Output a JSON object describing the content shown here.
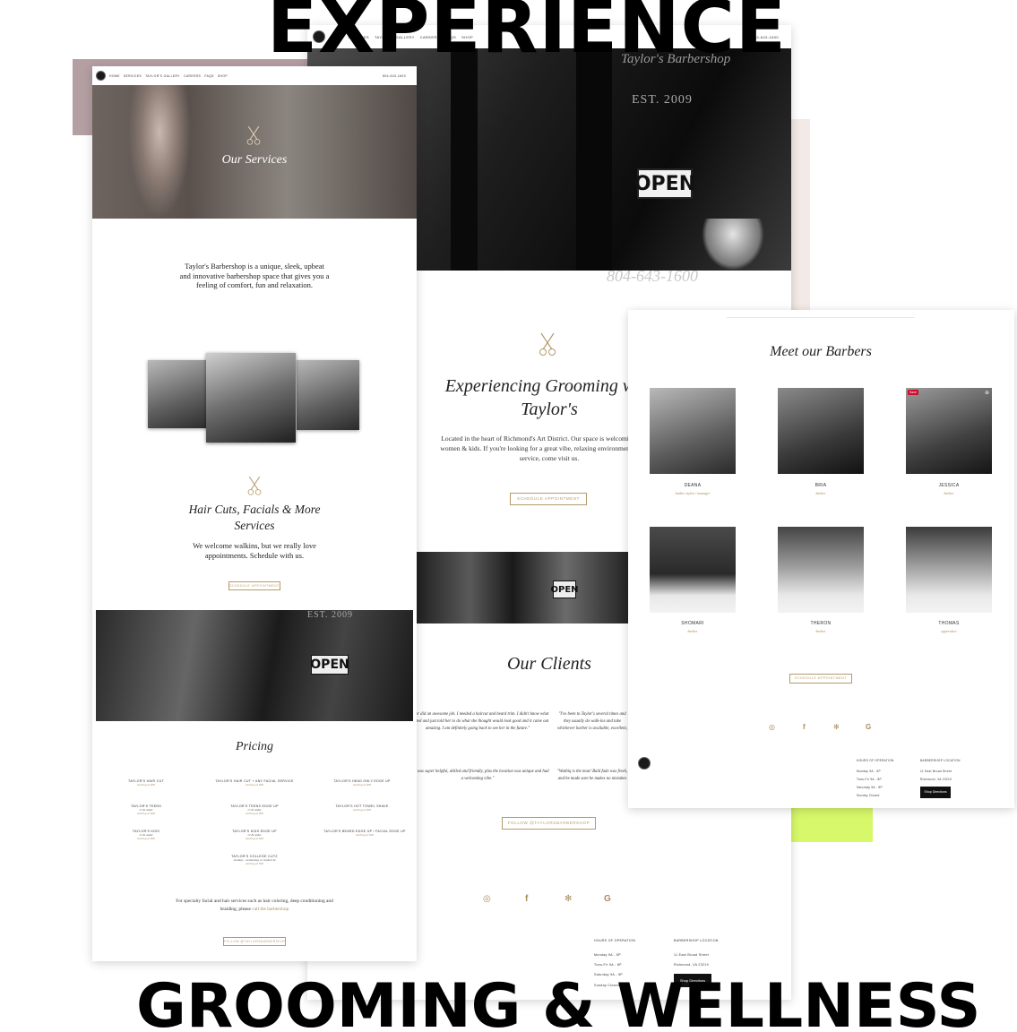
{
  "headlines": {
    "top": "EXPERIENCE",
    "bottom": "GROOMING & WELLNESS"
  },
  "colors": {
    "accent": "#a98b5c",
    "lime": "#d7f86a",
    "mauve": "#b49fa3",
    "blush": "#f3e9e6"
  },
  "left_page": {
    "nav": [
      "HOME",
      "SERVICES",
      "TAYLOR'S GALLERY",
      "CAREERS",
      "FAQS",
      "SHOP"
    ],
    "phone": "804-643-1600",
    "hero_title": "Our Services",
    "intro": "Taylor's Barbershop is a unique, sleek, upbeat and innovative barbershop space that gives you a feeling of comfort, fun and relaxation.",
    "section_title": "Hair Cuts, Facials & More Services",
    "section_text": "We welcome walkins, but we really love appointments.  Schedule with us.",
    "schedule_btn": "SCHEDULE APPOINTMENT",
    "photo_sign": "OPEN",
    "photo_est": "EST. 2009",
    "pricing_title": "Pricing",
    "pricing": [
      {
        "name": "TAYLOR'S HAIR CUT",
        "sub": "",
        "price": "starting at $00"
      },
      {
        "name": "TAYLOR'S HAIR CUT + ANY FACIAL SERVICE",
        "sub": "",
        "price": "starting at $00"
      },
      {
        "name": "TAYLOR'S HEAD ONLY EDGE UP",
        "sub": "",
        "price": "starting at $00"
      },
      {
        "name": "TAYLOR'S TEENS",
        "sub": "17 & under",
        "price": "starting at $00"
      },
      {
        "name": "TAYLOR'S TEENS EDGE UP",
        "sub": "17 & under",
        "price": "starting at $00"
      },
      {
        "name": "TAYLOR'S HOT TOWEL SHAVE",
        "sub": "",
        "price": "starting at $00"
      },
      {
        "name": "TAYLOR'S KIDS",
        "sub": "12 & under",
        "price": "starting at $00"
      },
      {
        "name": "TAYLOR'S KIDS EDGE UP",
        "sub": "12 & under",
        "price": "starting at $00"
      },
      {
        "name": "TAYLOR'S BEARD EDGE UP / FACIAL EDGE UP",
        "sub": "",
        "price": "starting at $00"
      },
      {
        "name": "TAYLOR'S COLLEGE CUTZ",
        "sub": "monday - wednesday w/ student id",
        "price": "starting at $00"
      }
    ],
    "footer_text": "For specialty facial and hair services such as hair coloring, deep conditioning and braiding, please",
    "footer_link": "call the barbershop",
    "follow_btn": "FOLLOW @TAYLORSBARBERSHOP"
  },
  "middle_page": {
    "nav": [
      "HOME",
      "SERVICES",
      "TAYLOR'S GALLERY",
      "CAREERS",
      "FAQS",
      "SHOP"
    ],
    "phone": "804-643-1600",
    "hero_sign": "OPEN",
    "hero_window": "Taylor's Barbershop",
    "hero_est": "EST. 2009",
    "hero_phone": "804-643-1600",
    "title": "Experiencing Grooming with Taylor's",
    "text": "Located in the heart of Richmond's Art District.  Our space is welcoming to men, women & kids.  If you're looking for a great vibe, relaxing environment and great service, come visit us.",
    "schedule_btn": "SCHEDULE APPOINTMENT",
    "strip_sign": "OPEN",
    "clients_title": "Our Clients",
    "testimonials": [
      "\"Taylor did an awesome job. I needed a haircut and beard trim. I didn't know what I wanted and just told her to do what she thought would look good and it came out amazing. I am definitely going back to see her in the future.\"",
      "\"I've been to Taylor's several times and they usually do walk-ins and take whichever barber is available, excellent, you won't be disappointed.\"",
      "\"Staff was super helpful, skilled and friendly, plus the location was unique and had a welcoming vibe.\"",
      "\"Wathiq is the man! Bald fade was fresh, and he made sure he makes no mistakes and that you leave happy.\""
    ],
    "follow_btn": "FOLLOW @TAYLORSBARBERSHOP",
    "social_icons": [
      "instagram-icon",
      "facebook-icon",
      "yelp-icon",
      "google-icon"
    ],
    "hours_title": "HOURS OF OPERATION",
    "hours": [
      "Monday 9A - 5P",
      "Tues-Fri 9A - 8P",
      "Saturday 9A - 5P",
      "Sunday Closed"
    ],
    "location_title": "BARBERSHOP LOCATION",
    "address": [
      "11 East Broad Street",
      "Richmond, VA 23219"
    ],
    "directions_btn": "Shop Directions"
  },
  "right_page": {
    "title": "Meet our Barbers",
    "barbers": [
      {
        "name": "DEANA",
        "role": "barber stylist / manager"
      },
      {
        "name": "BRIA",
        "role": "barber"
      },
      {
        "name": "JESSICA",
        "role": "barber"
      },
      {
        "name": "SHOMARI",
        "role": "barber"
      },
      {
        "name": "THERON",
        "role": "barber"
      },
      {
        "name": "THOMAS",
        "role": "apprentice"
      }
    ],
    "pin_label": "Save",
    "schedule_btn": "SCHEDULE APPOINTMENT",
    "social_icons": [
      "instagram-icon",
      "facebook-icon",
      "yelp-icon",
      "google-icon"
    ],
    "hours_title": "HOURS OF OPERATION",
    "hours": [
      "Monday 9A - 5P",
      "Tues-Fri 9A - 8P",
      "Saturday 9A - 5P",
      "Sunday Closed"
    ],
    "location_title": "BARBERSHOP LOCATION",
    "address": [
      "11 East Broad Street",
      "Richmond, VA 23219"
    ],
    "directions_btn": "Shop Directions"
  }
}
